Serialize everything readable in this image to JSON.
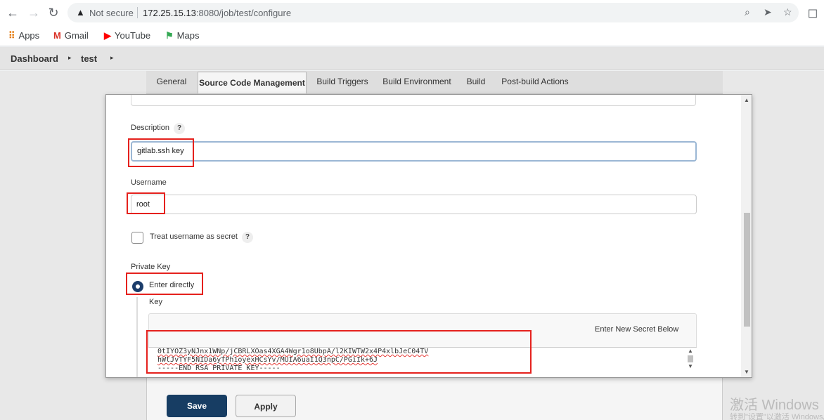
{
  "browser": {
    "security_label": "Not secure",
    "url_host": "172.25.15.13",
    "url_rest": ":8080/job/test/configure",
    "bookmarks": [
      {
        "label": "Apps",
        "icon": "apps-grid-icon",
        "color": "#e37400"
      },
      {
        "label": "Gmail",
        "icon": "gmail-icon",
        "color": "#d93025"
      },
      {
        "label": "YouTube",
        "icon": "youtube-icon",
        "color": "#ff0000"
      },
      {
        "label": "Maps",
        "icon": "maps-icon",
        "color": "#34a853"
      }
    ]
  },
  "breadcrumb": {
    "items": [
      "Dashboard",
      "test"
    ]
  },
  "tabs": [
    "General",
    "Source Code Management",
    "Build Triggers",
    "Build Environment",
    "Build",
    "Post-build Actions"
  ],
  "active_tab": "Source Code Management",
  "dialog": {
    "description_label": "Description",
    "description_value": "gitlab.ssh key",
    "username_label": "Username",
    "username_value": "root",
    "treat_secret_label": "Treat username as secret",
    "treat_secret_checked": false,
    "private_key_label": "Private Key",
    "enter_directly_label": "Enter directly",
    "key_label": "Key",
    "enter_new_secret": "Enter New Secret Below",
    "key_lines": [
      "0tIYOZ3yNJnx1WNp/jCBRLXOas4XGA4Wgr1o8UbpA/l2KIWTW2x4P4xlbJeC04TV",
      "hWtJvTYF5NIDa6yTPh1oyexHCsYv/MUIA6uaI1Q3npC/PGiIk+6J",
      "-----END RSA PRIVATE KEY-----"
    ],
    "help_glyph": "?"
  },
  "buttons": {
    "save": "Save",
    "apply": "Apply"
  },
  "watermark": {
    "line1": "激活 Windows",
    "line2": "转到\"设置\"以激活 Windows。"
  },
  "colors": {
    "highlight": "#e5211d",
    "save_bg": "#173d63",
    "radio": "#1c3d6b"
  }
}
